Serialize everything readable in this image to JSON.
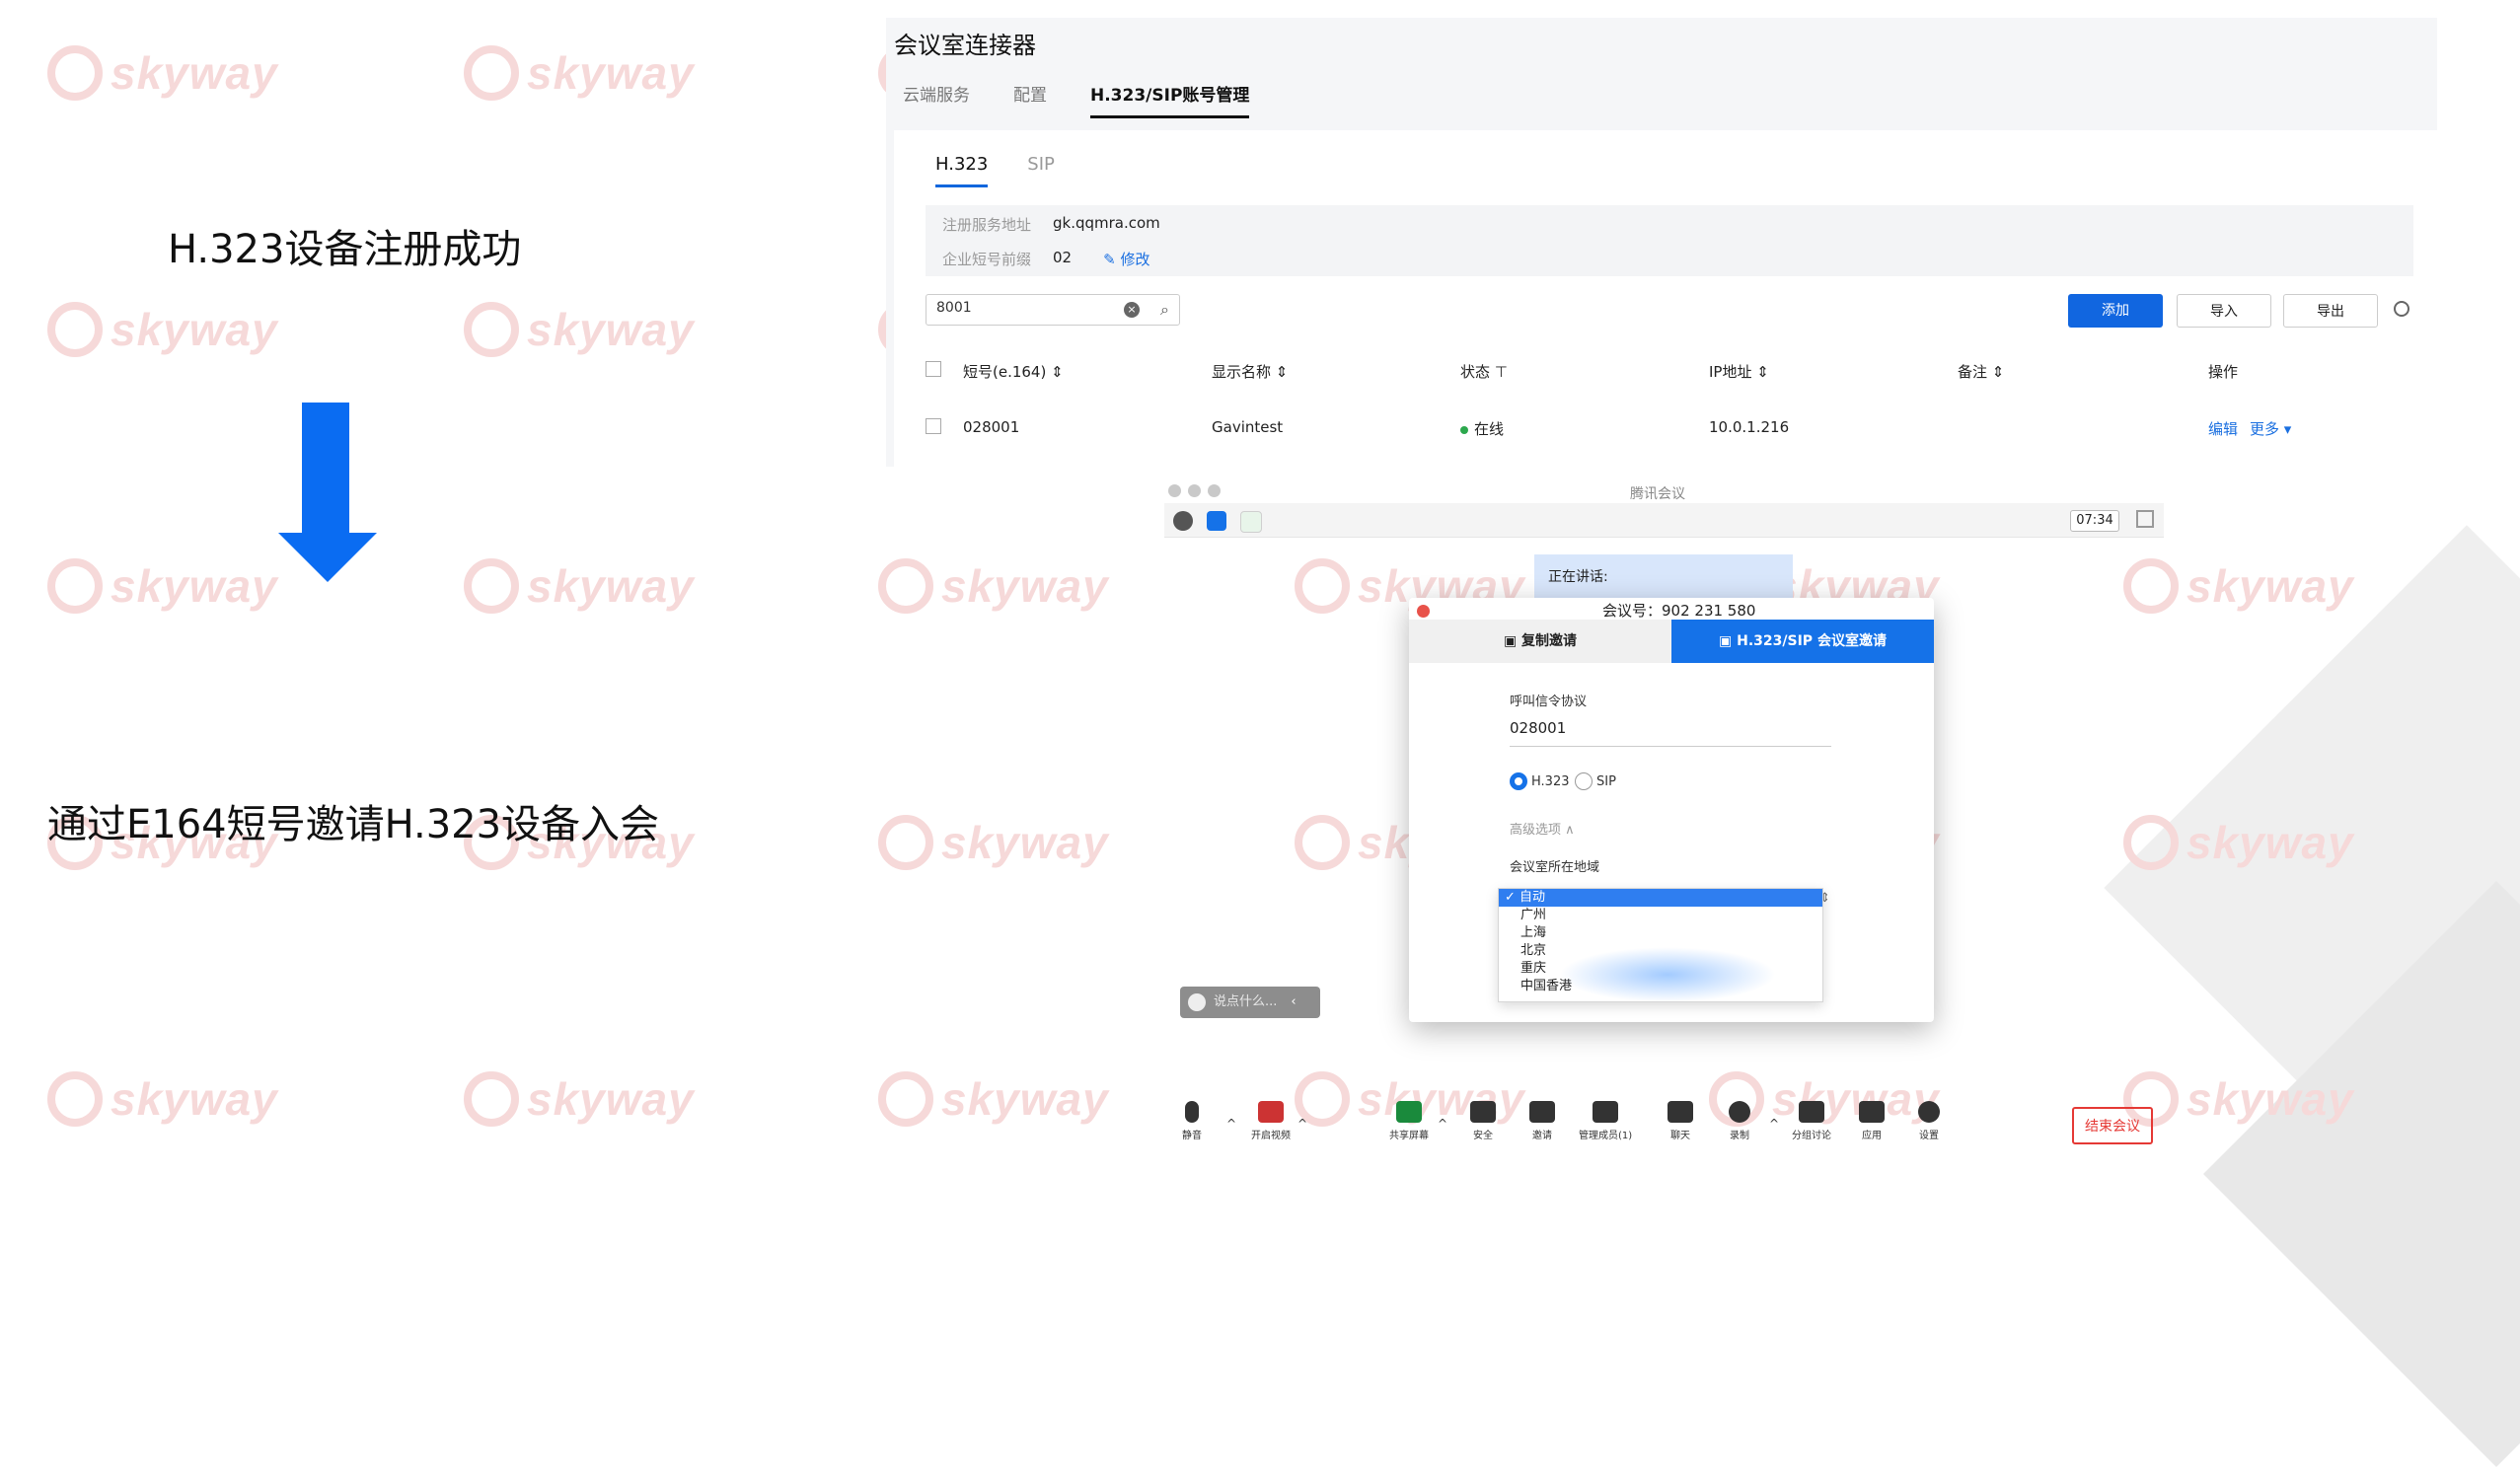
{
  "left": {
    "label_registered": "H.323设备注册成功",
    "label_invite": "通过E164短号邀请H.323设备入会"
  },
  "watermark": {
    "text": "skyway"
  },
  "web": {
    "title": "会议室连接器",
    "tabs": [
      "云端服务",
      "配置",
      "H.323/SIP账号管理"
    ],
    "subtabs": [
      "H.323",
      "SIP"
    ],
    "info": {
      "server_label": "注册服务地址",
      "server_value": "gk.qqmra.com",
      "prefix_label": "企业短号前缀",
      "prefix_value": "02",
      "edit_label": "修改"
    },
    "search_value": "8001",
    "buttons": {
      "add": "添加",
      "import": "导入",
      "export": "导出"
    },
    "columns": [
      "短号(e.164) ⇕",
      "显示名称 ⇕",
      "状态 ⊤",
      "IP地址 ⇕",
      "备注 ⇕",
      "操作"
    ],
    "row": {
      "e164": "028001",
      "name": "Gavintest",
      "status": "在线",
      "ip": "10.0.1.216",
      "action_edit": "编辑",
      "action_more": "更多 ▾"
    }
  },
  "meeting": {
    "window_title": "腾讯会议",
    "timer": "07:34",
    "speaking": "正在讲话:",
    "chat_placeholder": "说点什么...",
    "dialog": {
      "title": "会议号：902 231 580",
      "tab_copy": "复制邀请",
      "tab_h323": "H.323/SIP 会议室邀请",
      "protocol_label": "呼叫信令协议",
      "number_value": "028001",
      "radio_h323": "H.323",
      "radio_sip": "SIP",
      "advanced": "高级选项 ∧",
      "region_label": "会议室所在地域",
      "region_options": [
        "✓ 自动",
        "广州",
        "上海",
        "北京",
        "重庆",
        "中国香港"
      ]
    },
    "toolbar": [
      "静音",
      "开启视频",
      "共享屏幕",
      "安全",
      "邀请",
      "管理成员(1)",
      "聊天",
      "录制",
      "分组讨论",
      "应用",
      "设置"
    ],
    "end_button": "结束会议"
  }
}
